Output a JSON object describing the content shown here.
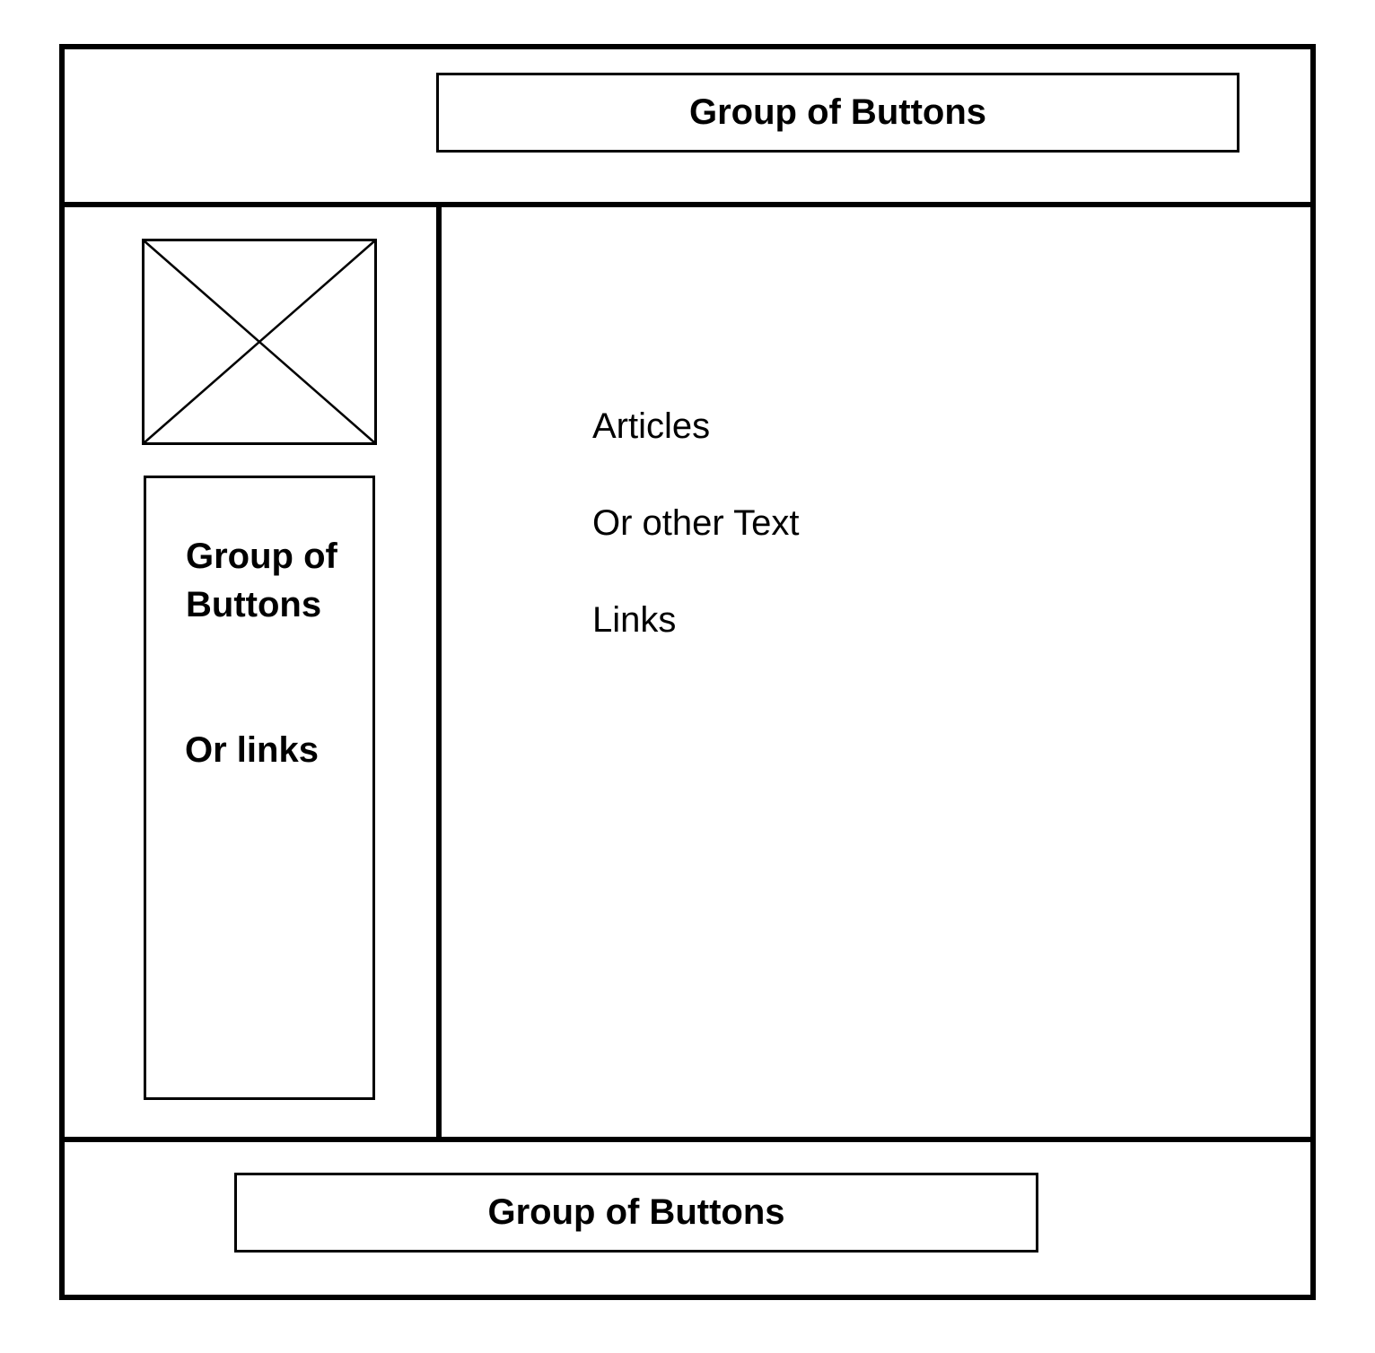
{
  "header": {
    "button_group_label": "Group of Buttons"
  },
  "sidebar": {
    "image_icon": "image-placeholder-icon",
    "group_title": "Group of Buttons",
    "links_label": "Or links"
  },
  "main": {
    "lines": [
      "Articles",
      "Or other Text",
      "Links"
    ]
  },
  "footer": {
    "button_group_label": "Group of Buttons"
  }
}
